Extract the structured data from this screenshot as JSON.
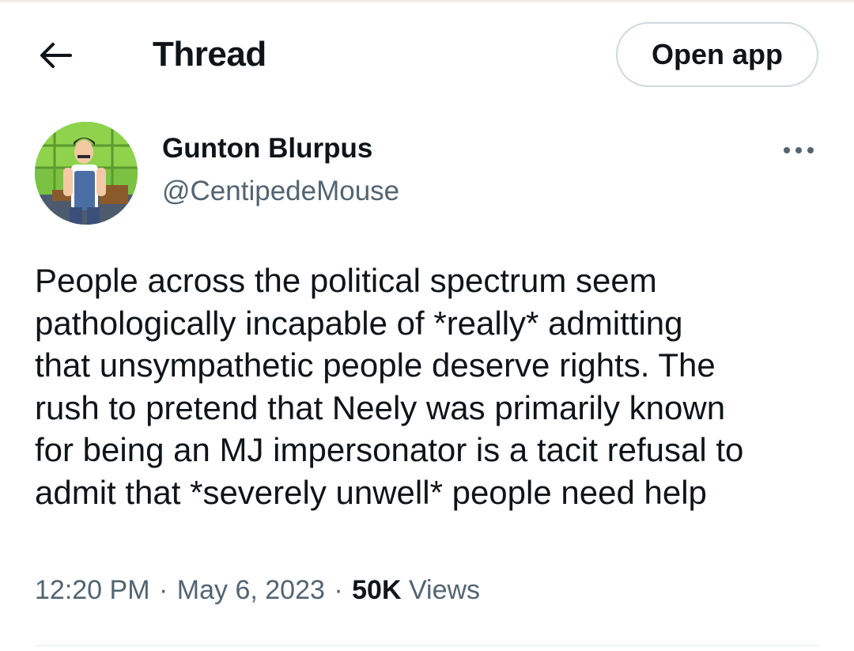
{
  "header": {
    "title": "Thread",
    "open_app_label": "Open app"
  },
  "tweet": {
    "author_name": "Gunton Blurpus",
    "author_handle": "@CentipedeMouse",
    "text": "People across the political spectrum seem\npathologically incapable of *really* admitting\nthat unsympathetic people deserve rights. The\nrush to pretend that Neely was primarily known\nfor being an MJ impersonator is a tacit refusal to\nadmit that *severely unwell* people need help",
    "time": "12:20 PM",
    "separator": "·",
    "date": "May 6, 2023",
    "views_count": "50K",
    "views_label": "Views"
  },
  "icons": {
    "back": "arrow-left-icon",
    "more": "more-horizontal-icon"
  },
  "colors": {
    "text_primary": "#0f1419",
    "text_secondary": "#536471",
    "border": "#cfd9de",
    "avatar_bg": "#7cc242"
  }
}
